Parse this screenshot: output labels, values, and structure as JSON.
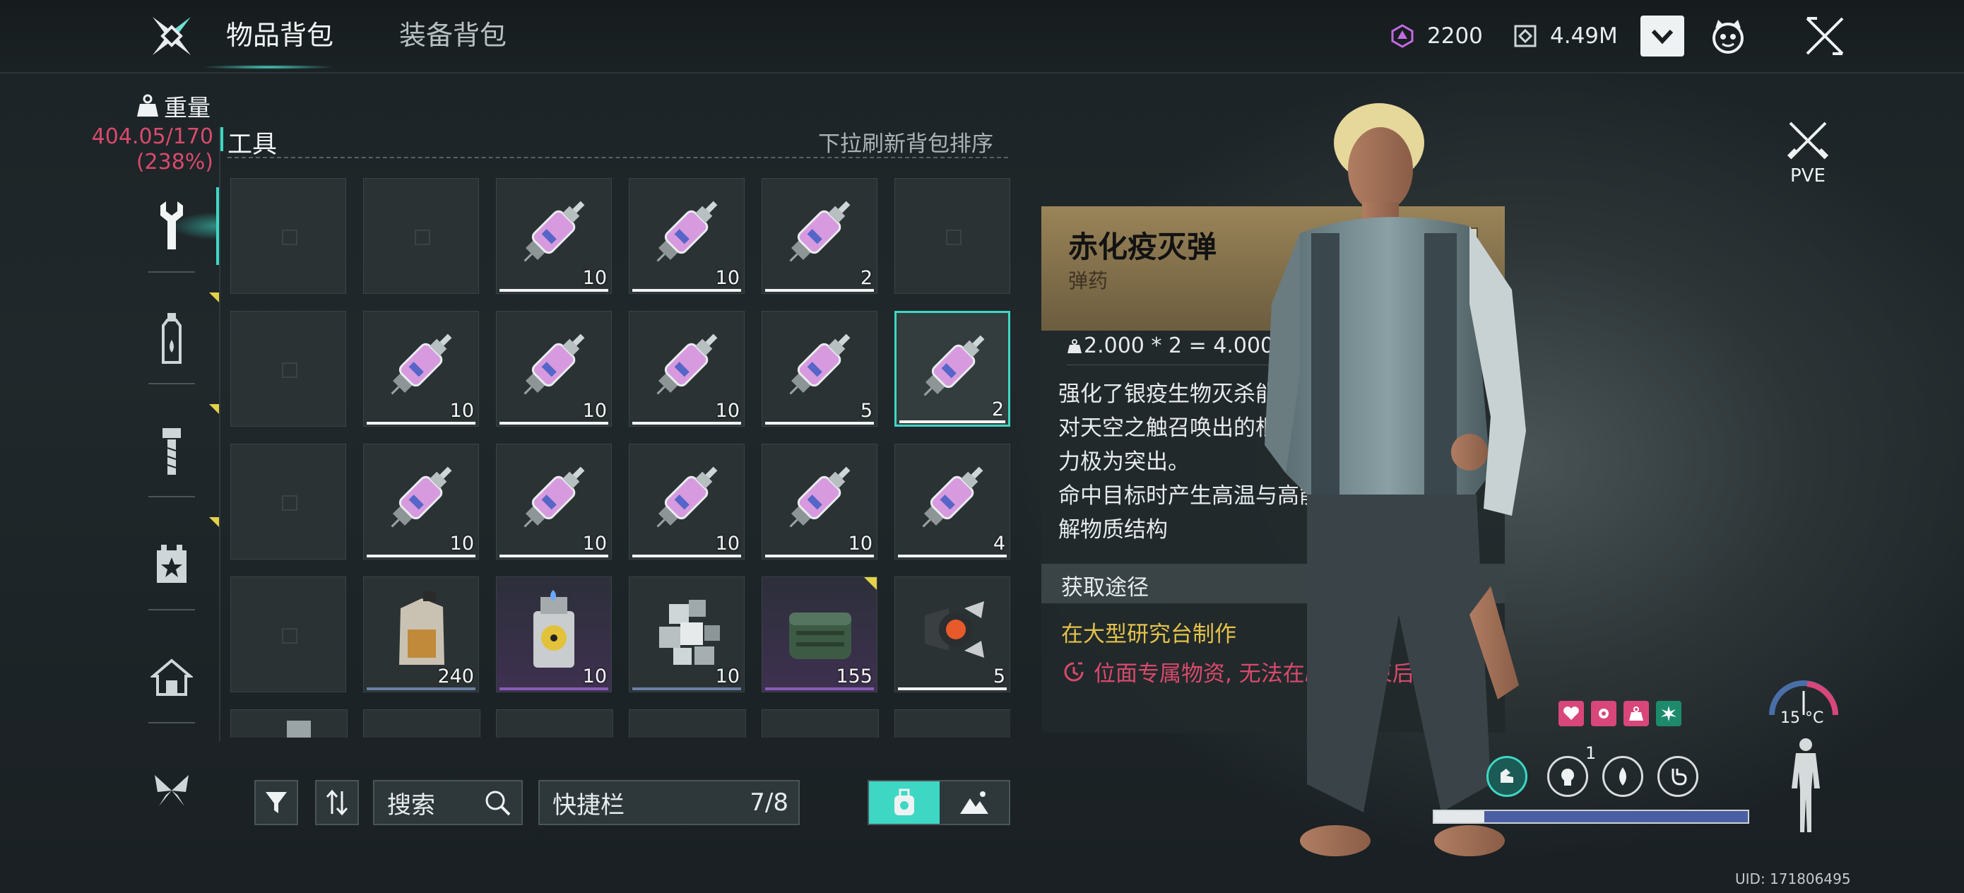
{
  "topbar": {
    "tabs": [
      {
        "label": "物品背包",
        "active": true
      },
      {
        "label": "装备背包",
        "active": false
      }
    ],
    "currency1": "2200",
    "currency2": "4.49M"
  },
  "sidebar": {
    "weight_label": "重量",
    "weight_value": "404.05/170",
    "weight_pct": "(238%)",
    "categories": [
      "tools-wrench-icon",
      "bottle-icon",
      "bolt-icon",
      "star-box-icon",
      "house-icon",
      "butterfly-icon"
    ]
  },
  "section": {
    "title": "工具",
    "hint": "下拉刷新背包排序"
  },
  "grid": {
    "rows": [
      [
        {
          "type": "empty"
        },
        {
          "type": "empty"
        },
        {
          "type": "syringe",
          "qty": "10"
        },
        {
          "type": "syringe",
          "qty": "10"
        },
        {
          "type": "syringe",
          "qty": "2"
        },
        {
          "type": "empty"
        }
      ],
      [
        {
          "type": "empty"
        },
        {
          "type": "syringe",
          "qty": "10"
        },
        {
          "type": "syringe",
          "qty": "10"
        },
        {
          "type": "syringe",
          "qty": "10"
        },
        {
          "type": "syringe",
          "qty": "5"
        },
        {
          "type": "syringe",
          "qty": "2",
          "selected": true
        }
      ],
      [
        {
          "type": "empty"
        },
        {
          "type": "syringe",
          "qty": "10"
        },
        {
          "type": "syringe",
          "qty": "10"
        },
        {
          "type": "syringe",
          "qty": "10"
        },
        {
          "type": "syringe",
          "qty": "10"
        },
        {
          "type": "syringe",
          "qty": "4"
        }
      ],
      [
        {
          "type": "empty"
        },
        {
          "type": "jug",
          "qty": "240"
        },
        {
          "type": "lighter",
          "qty": "10"
        },
        {
          "type": "cubes",
          "qty": "10"
        },
        {
          "type": "box",
          "qty": "155"
        },
        {
          "type": "lamp",
          "qty": "5"
        }
      ]
    ]
  },
  "controls": {
    "search_placeholder": "搜索",
    "quickbar_label": "快捷栏",
    "quickbar_count": "7/8"
  },
  "detail": {
    "name": "赤化疫灭弹",
    "type": "弹药",
    "weight_calc": "2.000 * 2 = 4.000",
    "description": [
      "强化了银疫生物灭杀能力的赤化电浆弹,",
      "对天空之触召唤出的根源眷属的灭杀能",
      "力极为突出。",
      "命中目标时产生高温与高能电离辐射, 瓦",
      "解物质结构"
    ],
    "acquire_title": "获取途径",
    "acquire_source": "在大型研究台制作",
    "acquire_warning": "位面专属物资, 无法在剧本结束后带离。"
  },
  "character": {
    "mode": "PVE",
    "temperature": "15 °C",
    "ring_badge": "1",
    "stamina_fraction": 0.16,
    "uid": "UID: 171806495"
  },
  "colors": {
    "accent": "#3ed7c4",
    "warning": "#d94a6c",
    "source": "#e3c24a",
    "header_gold": "#9a8458"
  }
}
